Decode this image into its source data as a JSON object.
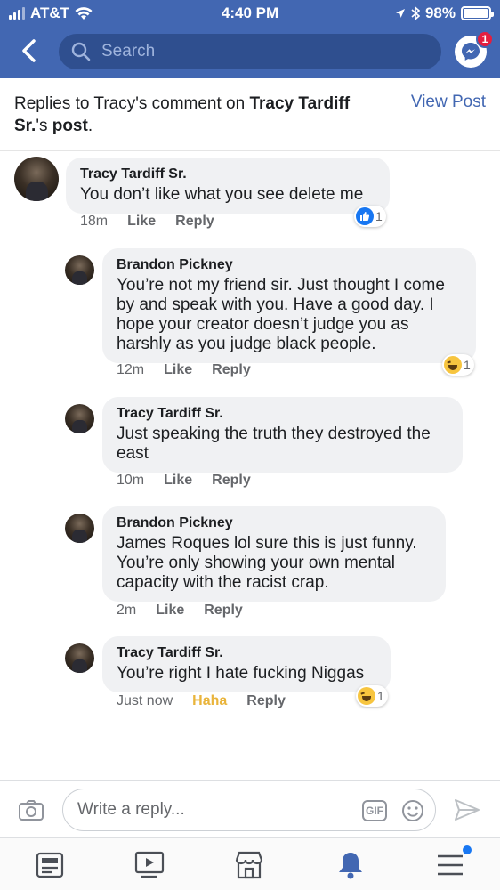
{
  "status": {
    "carrier": "AT&T",
    "time": "4:40 PM",
    "battery": "98%",
    "battery_level": 0.98
  },
  "nav": {
    "search_placeholder": "Search",
    "messenger_badge": "1"
  },
  "header": {
    "prefix": "Replies to Tracy's comment on ",
    "author": "Tracy Tardiff Sr.",
    "suffix_quote": "'s ",
    "post_word": "post",
    "period": ".",
    "view_post": "View Post"
  },
  "comments": [
    {
      "name": "Tracy Tardiff Sr.",
      "text": "You don’t like what you see delete me",
      "time": "18m",
      "like": "Like",
      "reply": "Reply",
      "reaction": "like-icon",
      "reaction_count": "1"
    },
    {
      "name": "Brandon Pickney",
      "text": "You’re not my friend sir. Just thought I come by and speak with you. Have a good day. I hope your creator doesn’t judge you as harshly as you judge black people.",
      "time": "12m",
      "like": "Like",
      "reply": "Reply",
      "reaction": "haha-icon",
      "reaction_count": "1"
    },
    {
      "name": "Tracy Tardiff Sr.",
      "text": "Just speaking the truth they destroyed the east",
      "time": "10m",
      "like": "Like",
      "reply": "Reply"
    },
    {
      "name": "Brandon Pickney",
      "text": "James Roques  lol sure this is just funny. You’re only showing your own mental capacity with the racist crap.",
      "time": "2m",
      "like": "Like",
      "reply": "Reply"
    },
    {
      "name": "Tracy Tardiff Sr.",
      "text": "You’re right I hate fucking Niggas",
      "time": "Just now",
      "like": "Haha",
      "reply": "Reply",
      "reaction": "haha-icon",
      "reaction_count": "1"
    }
  ],
  "composer": {
    "placeholder": "Write a reply...",
    "gif": "GIF"
  },
  "colors": {
    "brand": "#4267b2",
    "haha": "#e9b43b",
    "like": "#1877f2",
    "bubble": "#f0f1f3"
  }
}
